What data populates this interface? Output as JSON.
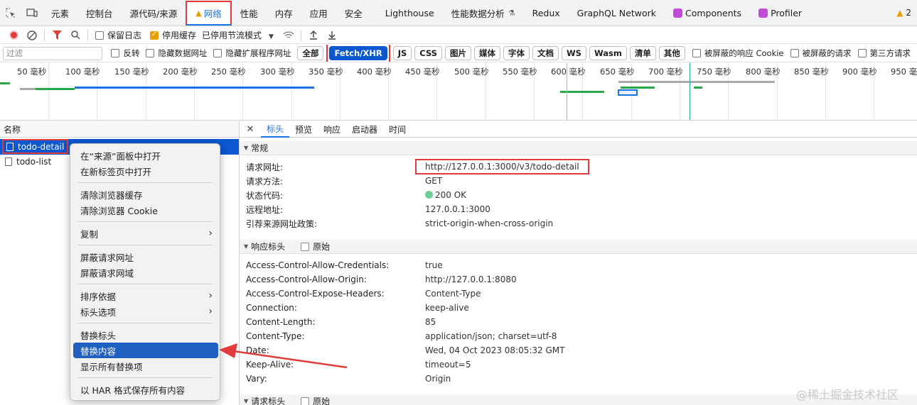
{
  "tabbar": {
    "tabs": [
      "元素",
      "控制台",
      "源代码/来源",
      "网络",
      "性能",
      "内存",
      "应用",
      "安全",
      "Lighthouse",
      "性能数据分析",
      "Redux",
      "GraphQL Network",
      "Components",
      "Profiler"
    ],
    "warning_count": "2"
  },
  "toolbar": {
    "preserve_log": "保留日志",
    "disable_cache": "停用缓存",
    "throttle": "已停用节流模式"
  },
  "filters": {
    "placeholder": "过滤",
    "invert": "反转",
    "hide_data_urls": "隐藏数据网址",
    "hide_ext_urls": "隐藏扩展程序网址",
    "types": [
      "全部",
      "Fetch/XHR",
      "JS",
      "CSS",
      "图片",
      "媒体",
      "字体",
      "文档",
      "WS",
      "Wasm",
      "清单",
      "其他"
    ],
    "blocked_cookies": "被屏蔽的响应 Cookie",
    "blocked_requests": "被屏蔽的请求",
    "third_party": "第三方请求"
  },
  "timeline": {
    "ticks": [
      "50 毫秒",
      "100 毫秒",
      "150 毫秒",
      "200 毫秒",
      "250 毫秒",
      "300 毫秒",
      "350 毫秒",
      "400 毫秒",
      "450 毫秒",
      "500 毫秒",
      "550 毫秒",
      "600 毫秒",
      "650 毫秒",
      "700 毫秒",
      "750 毫秒",
      "800 毫秒",
      "850 毫秒",
      "900 毫秒",
      "950 毫秒"
    ]
  },
  "left": {
    "header": "名称",
    "rows": [
      "todo-detail",
      "todo-list"
    ]
  },
  "context_menu": {
    "items": [
      "在“来源”面板中打开",
      "在新标签页中打开",
      "清除浏览器缓存",
      "清除浏览器 Cookie",
      "复制",
      "屏蔽请求网址",
      "屏蔽请求网域",
      "排序依据",
      "标头选项",
      "替换标头",
      "替换内容",
      "显示所有替换项",
      "以 HAR 格式保存所有内容"
    ]
  },
  "right": {
    "tabs": [
      "标头",
      "预览",
      "响应",
      "启动器",
      "时间"
    ],
    "general_title": "常规",
    "general": [
      {
        "k": "请求网址:",
        "v": "http://127.0.0.1:3000/v3/todo-detail"
      },
      {
        "k": "请求方法:",
        "v": "GET"
      },
      {
        "k": "状态代码:",
        "v": "200 OK"
      },
      {
        "k": "远程地址:",
        "v": "127.0.0.1:3000"
      },
      {
        "k": "引荐来源网址政策:",
        "v": "strict-origin-when-cross-origin"
      }
    ],
    "response_title": "响应标头",
    "raw_label": "原始",
    "response": [
      {
        "k": "Access-Control-Allow-Credentials:",
        "v": "true"
      },
      {
        "k": "Access-Control-Allow-Origin:",
        "v": "http://127.0.0.1:8080"
      },
      {
        "k": "Access-Control-Expose-Headers:",
        "v": "Content-Type"
      },
      {
        "k": "Connection:",
        "v": "keep-alive"
      },
      {
        "k": "Content-Length:",
        "v": "85"
      },
      {
        "k": "Content-Type:",
        "v": "application/json; charset=utf-8"
      },
      {
        "k": "Date:",
        "v": "Wed, 04 Oct 2023 08:05:32 GMT"
      },
      {
        "k": "Keep-Alive:",
        "v": "timeout=5"
      },
      {
        "k": "Vary:",
        "v": "Origin"
      }
    ],
    "request_title": "请求标头"
  },
  "watermark": "@稀土掘金技术社区"
}
